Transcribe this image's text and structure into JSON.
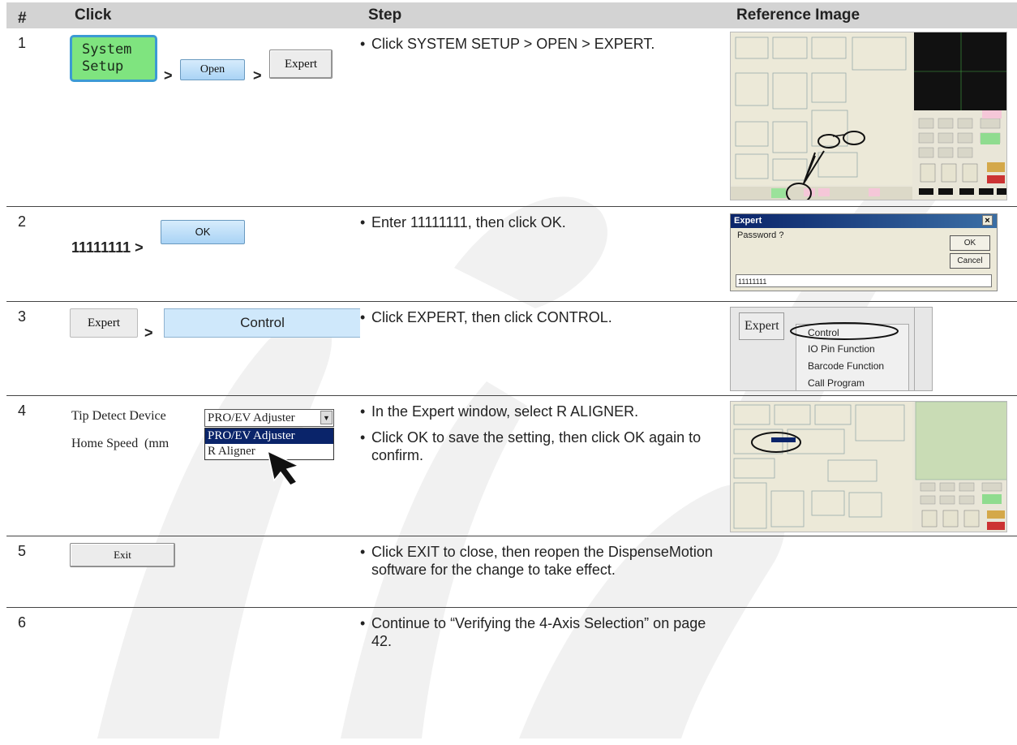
{
  "table": {
    "headers": {
      "num": "#",
      "click": "Click",
      "step": "Step",
      "ref": "Reference Image"
    },
    "rows": [
      {
        "num": "1",
        "click": {
          "system_btn_line1": "System",
          "system_btn_line2": "Setup",
          "sep1": ">",
          "open_label": "Open",
          "sep2": ">",
          "expert_label": "Expert"
        },
        "bullets": [
          "Click SYSTEM SETUP > OPEN > EXPERT."
        ]
      },
      {
        "num": "2",
        "click": {
          "password": "11111111 >",
          "ok_label": "OK"
        },
        "bullets": [
          "Enter 11111111, then click OK."
        ],
        "ref": {
          "title": "Expert",
          "close": "×",
          "prompt": "Password ?",
          "ok": "OK",
          "cancel": "Cancel",
          "input_value": "11111111"
        }
      },
      {
        "num": "3",
        "click": {
          "expert_label": "Expert",
          "sep": ">",
          "control_label": "Control"
        },
        "bullets": [
          "Click EXPERT, then click CONTROL."
        ],
        "ref": {
          "expert": "Expert",
          "menu": [
            "Control",
            "IO Pin Function",
            "Barcode Function",
            "Call Program"
          ]
        }
      },
      {
        "num": "4",
        "click": {
          "label": "Tip Detect Device",
          "selected": "PRO/EV Adjuster",
          "options": [
            "PRO/EV Adjuster",
            "R Aligner"
          ],
          "home_speed": "Home Speed",
          "home_unit": "(mm"
        },
        "bullets": [
          "In the Expert window, select R ALIGNER.",
          "Click OK to save the setting, then click OK again to confirm."
        ]
      },
      {
        "num": "5",
        "click": {
          "exit_label": "Exit"
        },
        "bullets": [
          "Click EXIT to close, then reopen the DispenseMotion software for the change to take effect."
        ]
      },
      {
        "num": "6",
        "bullets": [
          "Continue to “Verifying the 4-Axis Selection” on page 42."
        ]
      }
    ]
  },
  "bullet_char": "•",
  "colors": {
    "header_bg": "#d3d3d3",
    "system_btn": "#7fe47f",
    "button_blue": "#a9d3f5",
    "watermark": "#f2f2f2"
  }
}
